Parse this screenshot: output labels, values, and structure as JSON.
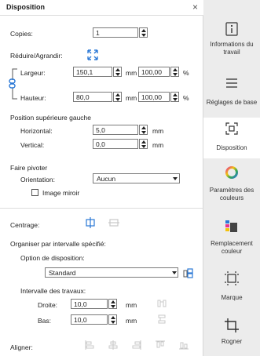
{
  "panel": {
    "title": "Disposition",
    "close_glyph": "×"
  },
  "copies": {
    "label": "Copies:",
    "value": "1"
  },
  "resize": {
    "label": "Réduire/Agrandir:",
    "width_label": "Largeur:",
    "width_mm": "150,1",
    "width_pct": "100,00",
    "height_label": "Hauteur:",
    "height_mm": "80,0",
    "height_pct": "100,00",
    "unit_mm": "mm",
    "unit_pct": "%"
  },
  "position": {
    "label": "Position supérieure gauche",
    "horizontal_label": "Horizontal:",
    "horizontal_value": "5,0",
    "vertical_label": "Vertical:",
    "vertical_value": "0,0",
    "unit": "mm"
  },
  "rotate": {
    "label": "Faire pivoter",
    "orientation_label": "Orientation:",
    "orientation_value": "Aucun",
    "mirror_label": "Image miroir",
    "mirror_checked": false
  },
  "centering": {
    "label": "Centrage:"
  },
  "arrange": {
    "label": "Organiser par intervalle spécifié:",
    "option_label": "Option de disposition:",
    "option_value": "Standard",
    "interval_label": "Intervalle des travaux:",
    "right_label": "Droite:",
    "right_value": "10,0",
    "bottom_label": "Bas:",
    "bottom_value": "10,0",
    "unit": "mm"
  },
  "align": {
    "label": "Aligner:"
  },
  "sidebar": {
    "items": [
      {
        "label": "Informations du travail",
        "icon": "info-icon"
      },
      {
        "label": "Réglages de base",
        "icon": "list-icon"
      },
      {
        "label": "Disposition",
        "icon": "layout-icon",
        "active": true
      },
      {
        "label": "Paramètres des couleurs",
        "icon": "color-wheel-icon"
      },
      {
        "label": "Remplacement couleur",
        "icon": "color-swatch-icon"
      },
      {
        "label": "Marque",
        "icon": "crop-marks-icon"
      },
      {
        "label": "Rogner",
        "icon": "crop-icon"
      }
    ]
  },
  "colors": {
    "accent_blue": "#2a78d6",
    "sidebar_bg": "#ececec",
    "active_bg": "#ffffff"
  }
}
